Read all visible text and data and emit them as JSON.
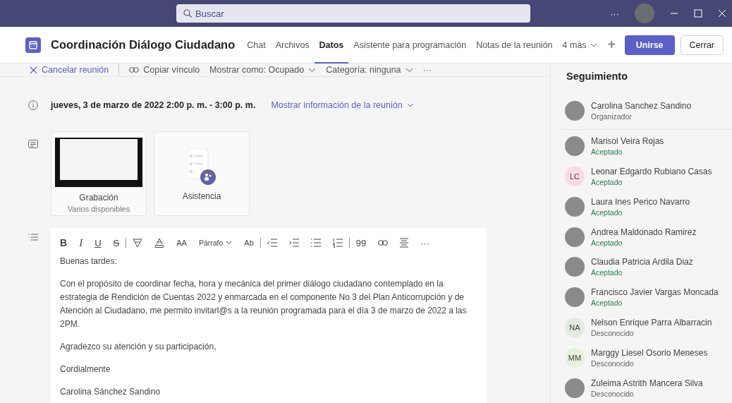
{
  "titlebar": {
    "search": {
      "placeholder": "Buscar"
    },
    "more": "···"
  },
  "header": {
    "title": "Coordinación Diálogo Ciudadano",
    "tabs": [
      {
        "label": "Chat",
        "selected": false
      },
      {
        "label": "Archivos",
        "selected": false
      },
      {
        "label": "Datos",
        "selected": true
      },
      {
        "label": "Asistente para programación",
        "selected": false
      },
      {
        "label": "Notas de la reunión",
        "selected": false
      }
    ],
    "more_tabs": "4 más",
    "add": "+",
    "join": "Unirse",
    "close": "Cerrar"
  },
  "toolbar": {
    "cancel": "Cancelar reunión",
    "copy_link": "Copiar vínculo",
    "show_as": "Mostrar como: Ocupado",
    "category": "Categoría: ninguna",
    "more": "···"
  },
  "meeting": {
    "datetime": "jueves, 3 de marzo de 2022 2:00 p. m. - 3:00 p. m.",
    "details_link": "Mostrar información de la reunión",
    "cards": [
      {
        "kind": "recording",
        "title": "Grabación",
        "subtitle": "Varios disponibles"
      },
      {
        "kind": "attendance",
        "title": "Asistencia"
      }
    ]
  },
  "editor": {
    "toolbar": {
      "format": [
        "B",
        "I",
        "U",
        "S"
      ],
      "font_size": "AA",
      "paragraph": "Párrafo",
      "clear_format": "Ab",
      "quote": "99",
      "more": "···"
    },
    "paragraphs": [
      "Buenas tardes:",
      "Con el propósito de coordinar fecha, hora y mecánica del primer diálogo ciudadano contemplado en la estrategia de Rendición de Cuentas 2022 y enmarcada en el componente No 3 del Plan Anticorrupción y de Atención al Ciudadano, me permito invitarl@s a la reunión programada para el día 3 de marzo de 2022 a las 2PM.",
      "Agradezco su atención y su participación,",
      "Cordialmente",
      "Carolina Sánchez Sandino"
    ]
  },
  "tracking": {
    "title": "Seguimiento",
    "people": [
      {
        "name": "Carolina Sanchez Sandino",
        "status": "Organizador",
        "kind": "organizer"
      },
      {
        "name": "Marisol Veira Rojas",
        "status": "Aceptado",
        "kind": "accepted"
      },
      {
        "name": "Leonar Edgardo Rubiano Casas",
        "status": "Aceptado",
        "kind": "accepted",
        "initials": "LC",
        "color": "#f9dbe5"
      },
      {
        "name": "Laura Ines Perico Navarro",
        "status": "Aceptado",
        "kind": "accepted"
      },
      {
        "name": "Andrea Maldonado Ramirez",
        "status": "Aceptado",
        "kind": "accepted"
      },
      {
        "name": "Claudia Patricia Ardila Diaz",
        "status": "Aceptado",
        "kind": "accepted"
      },
      {
        "name": "Francisco Javier Vargas Moncada",
        "status": "Aceptado",
        "kind": "accepted"
      },
      {
        "name": "Nelson Enrique Parra Albarracin",
        "status": "Desconocido",
        "kind": "unknown",
        "initials": "NA",
        "color": "#e3eadf"
      },
      {
        "name": "Marggy Liesel Osorio Meneses",
        "status": "Desconocido",
        "kind": "unknown",
        "initials": "MM",
        "color": "#e6f1dc"
      },
      {
        "name": "Zuleima Astrith Mancera Silva",
        "status": "Desconocido",
        "kind": "unknown"
      }
    ]
  }
}
